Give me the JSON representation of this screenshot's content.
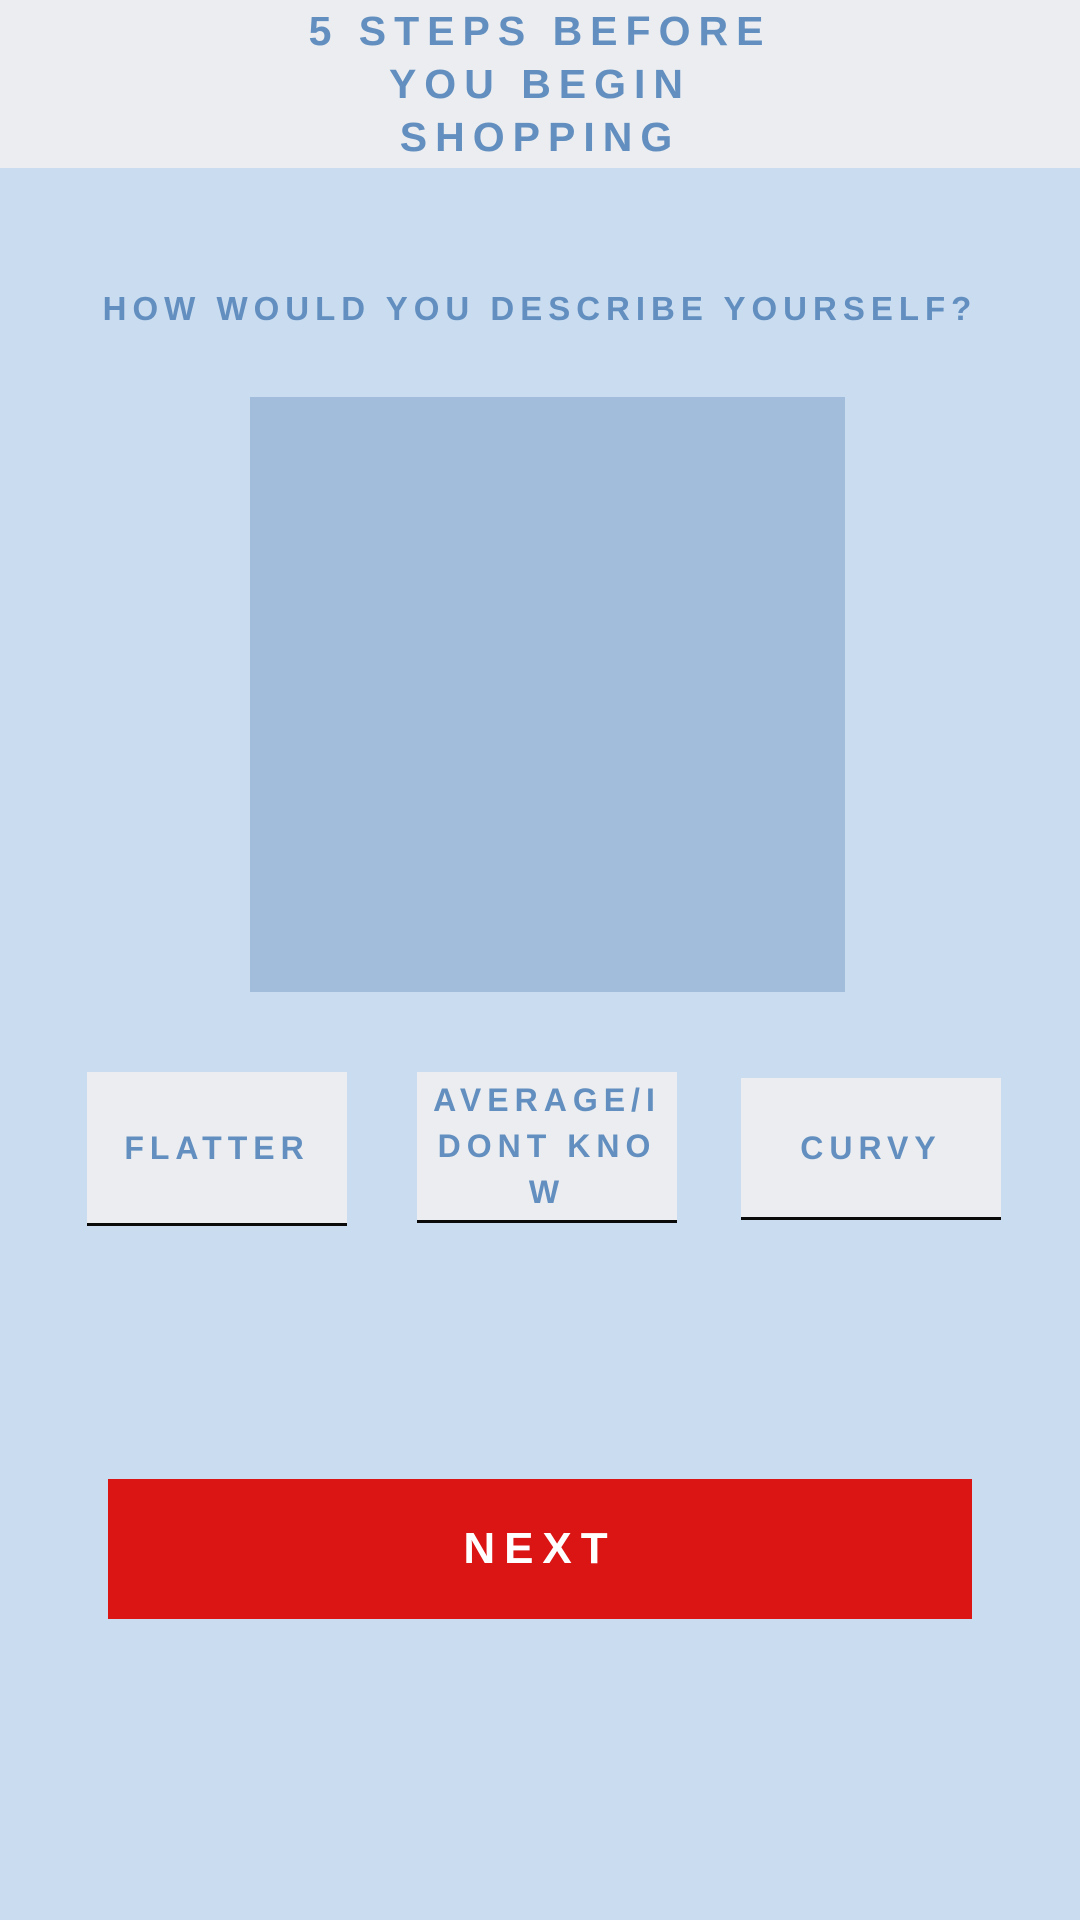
{
  "header": {
    "title": "5 STEPS BEFORE YOU BEGIN SHOPPING"
  },
  "question": {
    "text": "HOW WOULD YOU DESCRIBE YOURSELF?"
  },
  "options": [
    {
      "label": "FLATTER"
    },
    {
      "label": "AVERAGE/I DONT KNOW"
    },
    {
      "label": "CURVY"
    }
  ],
  "next_button": {
    "label": "NEXT"
  },
  "colors": {
    "background": "#cadcf0",
    "header_background": "#ebedf0",
    "accent_text": "#628fbf",
    "image_placeholder": "#a1bddb",
    "option_background": "#ebedf0",
    "option_underline": "#0a0a0a",
    "next_button": "#db1414"
  }
}
